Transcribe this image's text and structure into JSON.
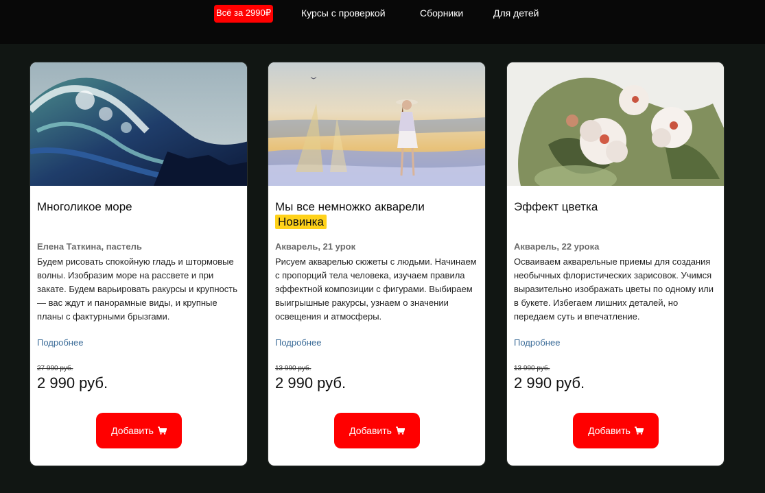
{
  "nav": {
    "items": [
      {
        "label": "Всё за 2990₽",
        "promo": true
      },
      {
        "label": "Курсы с проверкой"
      },
      {
        "label": "Сборники"
      },
      {
        "label": "Для детей"
      }
    ]
  },
  "cards": [
    {
      "title": "Многоликое море",
      "badge": "",
      "meta": "Елена Таткина, пастель",
      "description": "Будем рисовать спокойную гладь и штормовые волны. Изобразим море на рассвете и при закате. Будем варьировать ракурсы и крупность — вас ждут и панорамные виды, и крупные планы с фактурными брызгами.",
      "more": "Подробнее",
      "old_price": "27 990 руб.",
      "price": "2 990 руб.",
      "button": "Добавить",
      "image": "stormy-sea-wave-painting"
    },
    {
      "title": "Мы все немножко акварели",
      "badge": "Новинка",
      "meta": "Акварель, 21 урок",
      "description": "Рисуем акварелью сюжеты с людьми. Начинаем с пропорций тела человека, изучаем правила эффектной композиции с фигурами. Выбираем выигрышные ракурсы, узнаем о значении освещения и атмосферы.",
      "more": "Подробнее",
      "old_price": "13 990 руб.",
      "price": "2 990 руб.",
      "button": "Добавить",
      "image": "girl-in-field-watercolor"
    },
    {
      "title": "Эффект цветка",
      "badge": "",
      "meta": "Акварель, 22 урока",
      "description": "Осваиваем акварельные приемы для создания необычных флористических зарисовок. Учимся выразительно изображать цветы по одному или в букете. Избегаем лишних деталей, но передаем суть и впечатление.",
      "more": "Подробнее",
      "old_price": "13 990 руб.",
      "price": "2 990 руб.",
      "button": "Добавить",
      "image": "white-flowers-watercolor"
    }
  ],
  "colors": {
    "accent": "#ff0000",
    "badge": "#ffd21a",
    "link": "#3d6d99",
    "page_bg": "#111613",
    "topbar_bg": "#080808"
  }
}
